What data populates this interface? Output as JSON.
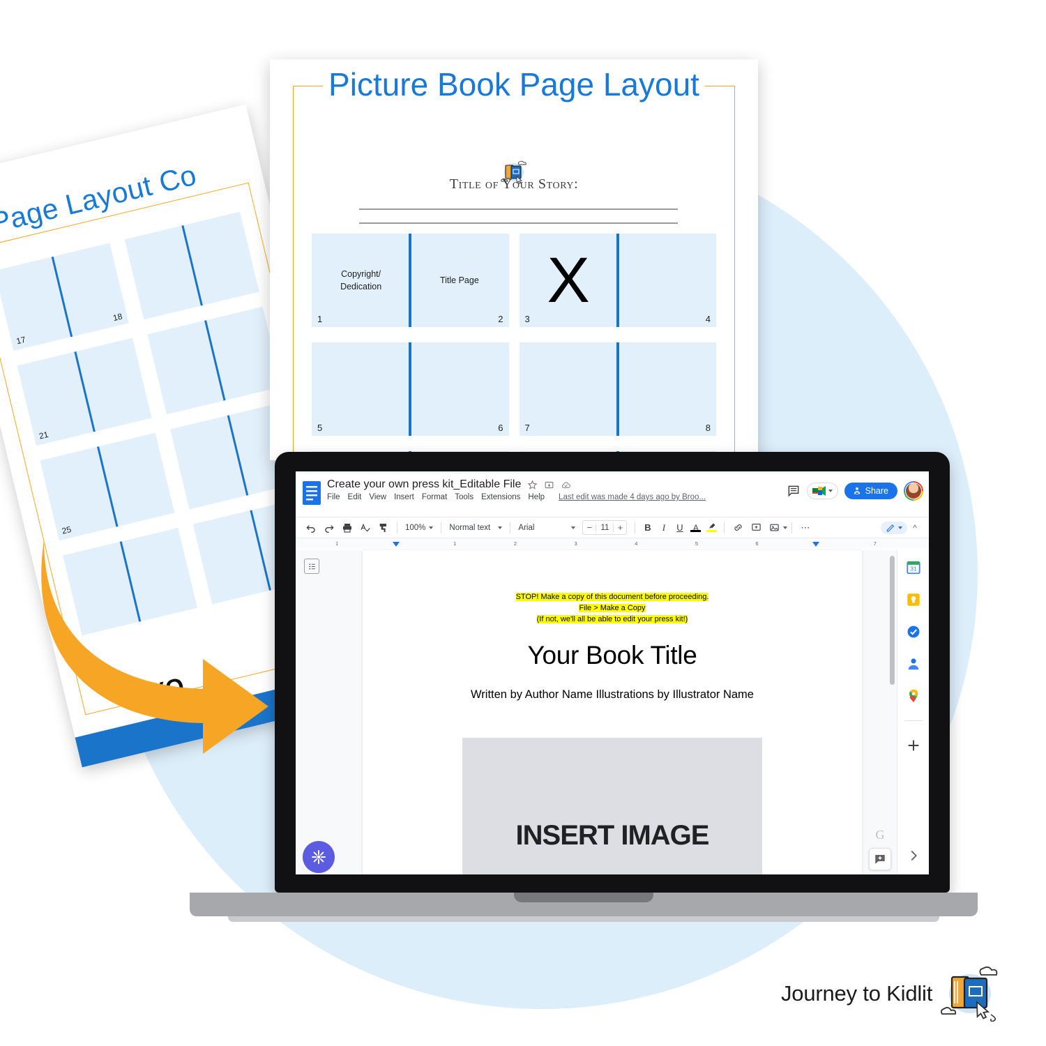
{
  "brand": {
    "name": "Journey to Kidlit",
    "logo_icon": "books-cloud-cursor-icon"
  },
  "background": {
    "blob_color": "#ddeefb"
  },
  "back_sheet": {
    "title": "Page Layout Co",
    "logo_icon": "books-cloud-cursor-icon",
    "frame_color": "#f5a623",
    "spread_color": "#e2f0fb",
    "gutter_color": "#1a74c9",
    "footer_color": "#1a74c9",
    "bottom_text": "YO",
    "rows": [
      {
        "left_num": "17",
        "right_num": "18"
      },
      {
        "left_num": "",
        "right_num": ""
      },
      {
        "left_num": "21",
        "right_num": ""
      },
      {
        "left_num": "25",
        "right_num": ""
      }
    ]
  },
  "front_sheet": {
    "title": "Picture Book Page Layout",
    "title_color": "#1879d8",
    "logo_icon": "books-cloud-cursor-icon",
    "story_label": "Title of Your Story:",
    "frame_color": "#f5a623",
    "spread_color": "#e2f0fb",
    "gutter_color": "#1a74c9",
    "rows": [
      {
        "spreads": [
          {
            "left_label": "Copyright/\nDedication",
            "right_label": "Title Page",
            "left_num": "1",
            "right_num": "2",
            "x": false
          },
          {
            "left_label": "",
            "right_label": "",
            "left_num": "3",
            "right_num": "4",
            "x": true
          }
        ]
      },
      {
        "spreads": [
          {
            "left_label": "",
            "right_label": "",
            "left_num": "5",
            "right_num": "6",
            "x": false
          },
          {
            "left_label": "",
            "right_label": "",
            "left_num": "7",
            "right_num": "8",
            "x": false
          }
        ]
      },
      {
        "spreads": [
          {
            "left_label": "",
            "right_label": "",
            "left_num": "",
            "right_num": "",
            "x": false
          },
          {
            "left_label": "",
            "right_label": "",
            "left_num": "",
            "right_num": "",
            "x": false
          }
        ]
      }
    ]
  },
  "arrow": {
    "color": "#f6a524",
    "direction": "down-right-curved"
  },
  "docs": {
    "doc_icon": "google-docs-icon",
    "title": "Create your own press kit_Editable File",
    "title_icons": [
      "star-icon",
      "move-to-folder-icon",
      "saved-to-drive-cloud-icon"
    ],
    "menus": [
      "File",
      "Edit",
      "View",
      "Insert",
      "Format",
      "Tools",
      "Extensions",
      "Help"
    ],
    "last_edit": "Last edit was made 4 days ago by Broo...",
    "comment_history_icon": "comment-history-icon",
    "meet_label": "google-meet-icon",
    "share_label": "Share",
    "share_icon": "share-lock-person-icon",
    "share_color": "#1a73e8",
    "avatar": "user-avatar",
    "toolbar": {
      "icons": [
        "undo-icon",
        "redo-icon",
        "print-icon",
        "spellcheck-icon",
        "paint-format-icon"
      ],
      "zoom": "100%",
      "paragraph_style": "Normal text",
      "font": "Arial",
      "font_size": "11",
      "bold": "B",
      "italic": "I",
      "underline": "U",
      "text_color_icon": "text-color-icon",
      "text_color": "#000000",
      "highlight_icon": "highlight-color-icon",
      "highlight_color": "#ffff00",
      "more_icons": [
        "insert-link-icon",
        "add-comment-icon",
        "insert-image-icon"
      ],
      "overflow": "⋯",
      "mode_icon": "editing-mode-pencil-icon",
      "collapse_icon": "chevron-up-icon"
    },
    "ruler": {
      "ticks": [
        "1",
        "1",
        "2",
        "3",
        "4",
        "5",
        "6",
        "7"
      ]
    },
    "outline_icon": "document-outline-icon",
    "side_rail_icons": [
      "google-calendar-icon",
      "google-keep-icon",
      "google-tasks-icon",
      "google-contacts-icon",
      "google-maps-icon",
      "add-ons-plus-icon",
      "expand-panel-chevron-icon"
    ],
    "grammarly_fab_icon": "grammarly-icon",
    "grammarly_fab_color": "#5c5ce0",
    "explore_g_icon": "grammarly-g-icon",
    "explore_icon": "explore-spark-icon"
  },
  "document_content": {
    "stop_line_1": "STOP! Make a copy of this document before proceeding.",
    "stop_line_2": "File >  Make a Copy",
    "stop_line_3": "(If not, we'll all be able to edit your press kit!)",
    "highlight_color": "#ffff00",
    "heading": "Your Book Title",
    "subheading": "Written by Author Name Illustrations by Illustrator Name",
    "image_placeholder": "INSERT IMAGE"
  }
}
